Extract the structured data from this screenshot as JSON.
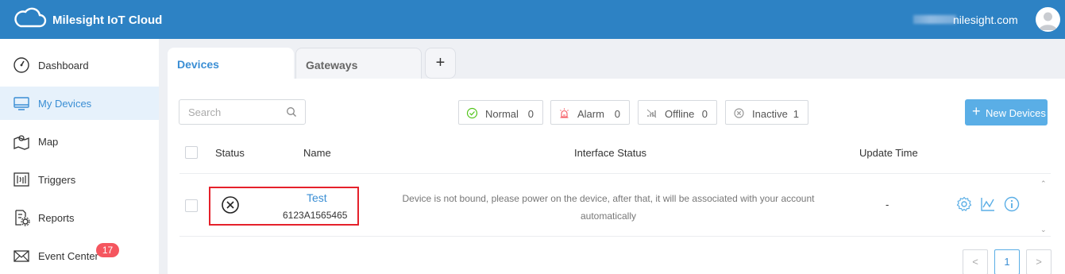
{
  "header": {
    "app_title": "Milesight IoT Cloud",
    "user_email": "nilesight.com"
  },
  "sidebar": {
    "items": [
      {
        "label": "Dashboard",
        "icon": "dashboard-gauge-icon"
      },
      {
        "label": "My Devices",
        "icon": "monitor-icon",
        "active": true
      },
      {
        "label": "Map",
        "icon": "map-icon"
      },
      {
        "label": "Triggers",
        "icon": "triggers-icon"
      },
      {
        "label": "Reports",
        "icon": "reports-gear-icon"
      },
      {
        "label": "Event Center",
        "icon": "envelope-icon",
        "badge": "17"
      }
    ]
  },
  "tabs": {
    "devices": "Devices",
    "gateways": "Gateways",
    "add": "+"
  },
  "toolbar": {
    "search_placeholder": "Search",
    "filters": [
      {
        "label": "Normal",
        "count": "0",
        "icon": "check-circle-icon",
        "color": "#52c41a"
      },
      {
        "label": "Alarm",
        "count": "0",
        "icon": "alarm-siren-icon",
        "color": "#f5565f"
      },
      {
        "label": "Offline",
        "count": "0",
        "icon": "signal-off-icon",
        "color": "#999999"
      },
      {
        "label": "Inactive",
        "count": "1",
        "icon": "x-circle-icon",
        "color": "#999999"
      }
    ],
    "new_button": "New Devices"
  },
  "table": {
    "columns": [
      "Status",
      "Name",
      "Interface Status",
      "Update Time"
    ],
    "rows": [
      {
        "status": "inactive",
        "name": "Test",
        "sn": "6123A1565465",
        "interface_status": "Device is not bound, please power on the device, after that, it will be associated with your account automatically",
        "update_time": "-"
      }
    ]
  },
  "pagination": {
    "prev": "<",
    "current": "1",
    "next": ">"
  },
  "colors": {
    "header": "#2d82c4",
    "accent": "#3a8ed4",
    "button": "#5aaee6",
    "badge": "#f5565f",
    "highlight": "#e5212b"
  }
}
